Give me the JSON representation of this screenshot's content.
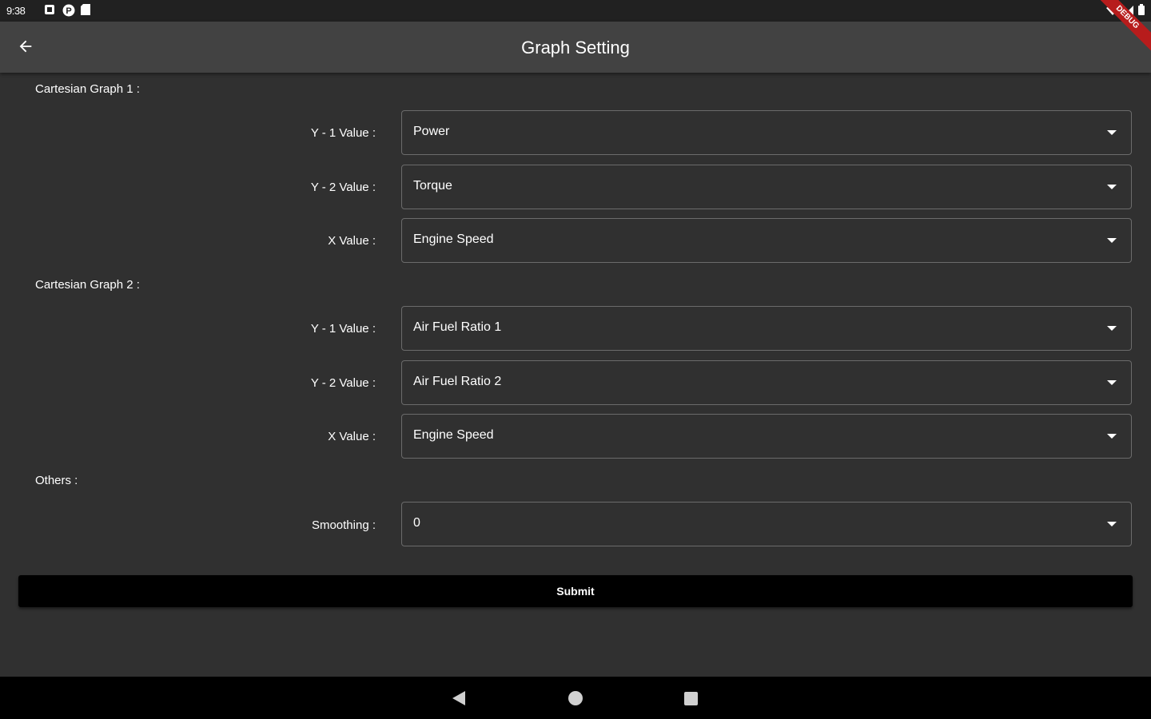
{
  "status_bar": {
    "time": "9:38",
    "icons": [
      "notification-icon",
      "p-badge-icon",
      "sd-card-icon"
    ],
    "right_icons": [
      "wifi-icon",
      "signal-icon",
      "battery-icon"
    ]
  },
  "app_bar": {
    "title": "Graph Setting",
    "back_icon": "arrow-back-icon"
  },
  "debug_banner": "DEBUG",
  "graph1": {
    "title": "Cartesian Graph 1 :",
    "rows": [
      {
        "label": "Y - 1 Value :",
        "value": "Power"
      },
      {
        "label": "Y - 2 Value :",
        "value": "Torque"
      },
      {
        "label": "X Value :",
        "value": "Engine Speed"
      }
    ]
  },
  "graph2": {
    "title": "Cartesian Graph 2 :",
    "rows": [
      {
        "label": "Y - 1 Value :",
        "value": "Air Fuel Ratio 1"
      },
      {
        "label": "Y - 2 Value :",
        "value": "Air Fuel Ratio 2"
      },
      {
        "label": "X Value :",
        "value": "Engine Speed"
      }
    ]
  },
  "others": {
    "title": "Others :",
    "rows": [
      {
        "label": "Smoothing :",
        "value": "0"
      }
    ]
  },
  "submit_label": "Submit",
  "colors": {
    "background": "#303030",
    "app_bar": "#424242",
    "status_bar": "#212121",
    "button": "#000000",
    "field_border": "#6b6b6b",
    "debug_banner": "#b71c1c"
  }
}
